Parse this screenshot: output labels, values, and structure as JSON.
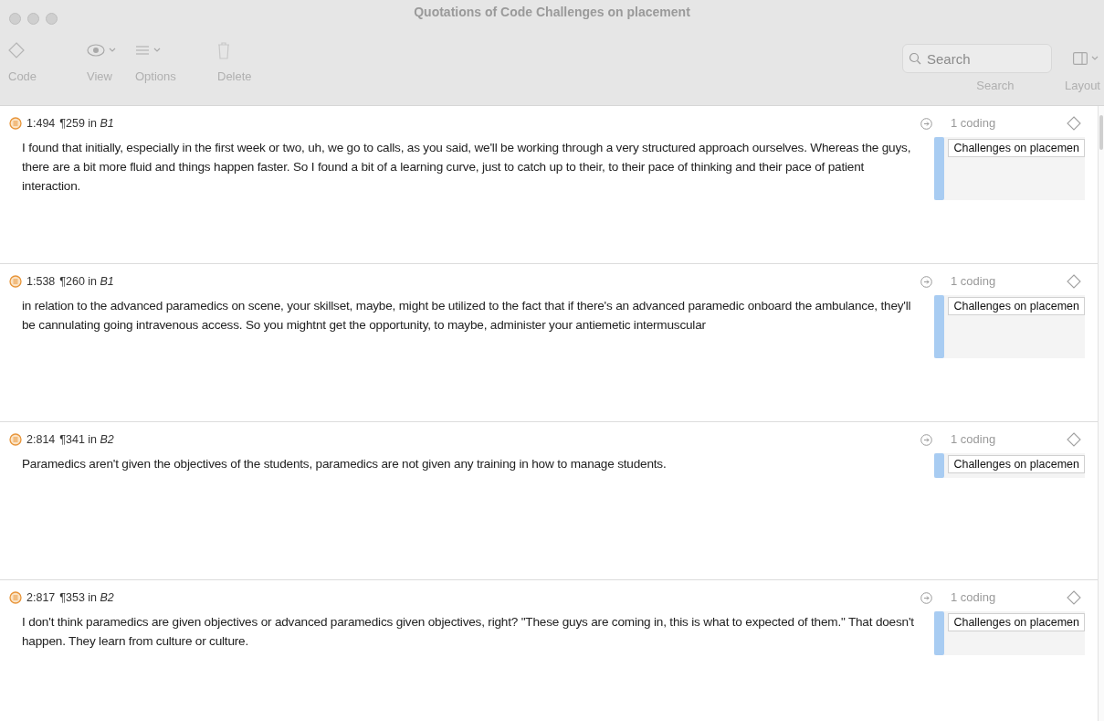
{
  "window": {
    "title": "Quotations of Code Challenges on placement"
  },
  "toolbar": [
    {
      "kind": "code",
      "label": "Code"
    },
    {
      "kind": "view",
      "label": "View"
    },
    {
      "kind": "options",
      "label": "Options"
    },
    {
      "kind": "delete",
      "label": "Delete"
    }
  ],
  "search": {
    "placeholder": "Search",
    "label": "Search"
  },
  "layout": {
    "label": "Layout"
  },
  "quotations": [
    {
      "ref": "1:494",
      "location": "¶259 in *B1*",
      "text": "I found that initially, especially in the first week or two, uh, we go to calls, as you said, we'll be working through a very structured approach ourselves. Whereas the guys, there are a bit more fluid and things happen faster. So I found a bit of a learning curve, just to catch up to their, to their pace of thinking and their pace of patient interaction.",
      "codings": "1 coding",
      "code": "Challenges on placemen"
    },
    {
      "ref": "1:538",
      "location": "¶260 in *B1*",
      "text": "in relation to the advanced paramedics on scene, your skillset, maybe, might be utilized to the fact that if there's an advanced paramedic onboard the ambulance, they'll be cannulating  going  intravenous access. So you mightnt get the opportunity, to maybe, administer your antiemetic intermuscular",
      "codings": "1 coding",
      "code": "Challenges on placemen"
    },
    {
      "ref": "2:814",
      "location": "¶341 in *B2*",
      "text": "Paramedics aren't given the objectives of the students, paramedics are not given any training in how to manage students.",
      "codings": "1 coding",
      "code": "Challenges on placemen"
    },
    {
      "ref": "2:817",
      "location": "¶353 in *B2*",
      "text": "I don't think paramedics are given objectives or advanced paramedics given objectives, right? \"These guys are coming in, this is what to expected of them.\" That doesn't happen. They learn from culture or culture.",
      "codings": "1 coding",
      "code": "Challenges on placemen"
    }
  ]
}
